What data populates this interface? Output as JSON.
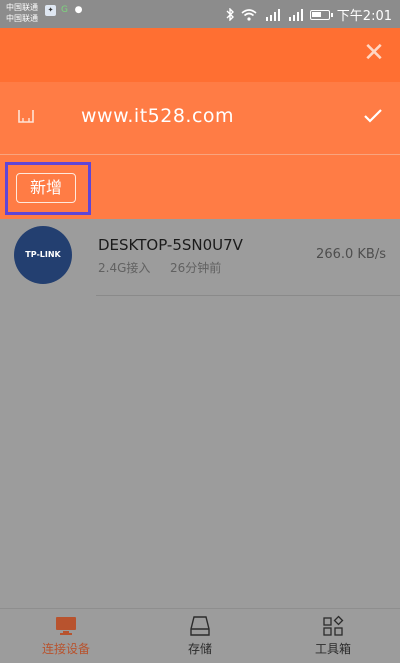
{
  "status_bar": {
    "carrier_1": "中国联通",
    "carrier_2": "中国联通",
    "icons": [
      "app-icon",
      "g-icon",
      "wechat-icon",
      "bluetooth-icon",
      "wifi-icon",
      "signal-4g-icon",
      "signal-2g-icon",
      "battery-icon"
    ],
    "time": "下午2:01"
  },
  "header": {
    "close_icon": "close-icon"
  },
  "network": {
    "name": "www.it528.com",
    "icon": "router-icon",
    "selected_icon": "checkmark-icon"
  },
  "actions": {
    "add_label": "新增"
  },
  "devices": [
    {
      "avatar_text": "TP-LINK",
      "name": "DESKTOP-5SN0U7V",
      "band": "2.4G接入",
      "time": "26分钟前",
      "speed": "266.0  KB/s"
    }
  ],
  "bottom_nav": [
    {
      "label": "连接设备",
      "icon": "monitor-icon",
      "active": true
    },
    {
      "label": "存储",
      "icon": "storage-icon",
      "active": false
    },
    {
      "label": "工具箱",
      "icon": "toolbox-icon",
      "active": false
    }
  ],
  "colors": {
    "accent": "#ff6f32",
    "accent_light": "#ff7c45",
    "overlay_gray": "#9c9c9c",
    "highlight_box": "#5f45d6",
    "active_nav": "#b8532e"
  }
}
